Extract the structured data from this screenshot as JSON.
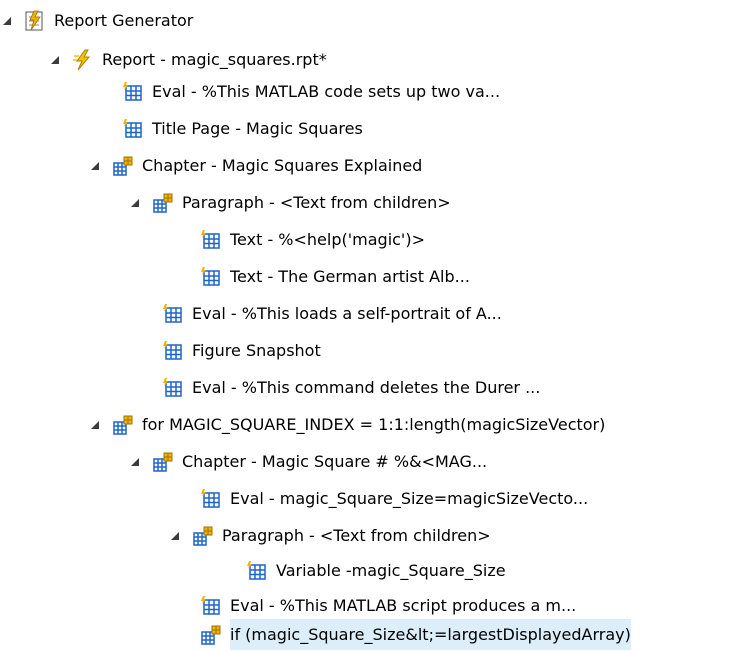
{
  "tree": {
    "nodes": [
      {
        "label": "Report Generator",
        "icon": "report-generator-icon",
        "expanded": true
      },
      {
        "label": "Report - magic_squares.rpt*",
        "icon": "lightning-icon",
        "expanded": true
      },
      {
        "label": "Eval - %This MATLAB code sets up two va...",
        "icon": "component-icon"
      },
      {
        "label": "Title Page - Magic Squares",
        "icon": "component-icon"
      },
      {
        "label": "Chapter - Magic Squares Explained",
        "icon": "parent-component-icon",
        "expanded": true
      },
      {
        "label": "Paragraph - <Text from children>",
        "icon": "parent-component-icon",
        "expanded": true
      },
      {
        "label": "Text - %<help('magic')>",
        "icon": "component-icon"
      },
      {
        "label": "Text - The German artist Alb...",
        "icon": "component-icon"
      },
      {
        "label": "Eval - %This loads a self-portrait of A...",
        "icon": "component-icon"
      },
      {
        "label": "Figure Snapshot",
        "icon": "component-icon"
      },
      {
        "label": "Eval - %This command deletes the Durer ...",
        "icon": "component-icon"
      },
      {
        "label": "for MAGIC_SQUARE_INDEX = 1:1:length(magicSizeVector)",
        "icon": "parent-component-icon",
        "expanded": true
      },
      {
        "label": "Chapter - Magic Square # %&<MAG...",
        "icon": "parent-component-icon",
        "expanded": true
      },
      {
        "label": "Eval - magic_Square_Size=magicSizeVecto...",
        "icon": "component-icon"
      },
      {
        "label": "Paragraph - <Text from children>",
        "icon": "parent-component-icon",
        "expanded": true
      },
      {
        "label": "Variable -magic_Square_Size",
        "icon": "component-icon"
      },
      {
        "label": "Eval - %This MATLAB script produces a m...",
        "icon": "component-icon"
      },
      {
        "label": "if (magic_Square_Size&lt;=largestDisplayedArray)",
        "icon": "parent-component-icon",
        "selected": true
      }
    ]
  },
  "colors": {
    "selection": "#dceefa",
    "icon_grid": "#1e64c8",
    "icon_gold": "#f0b400",
    "triangle": "#3c3c3c"
  }
}
